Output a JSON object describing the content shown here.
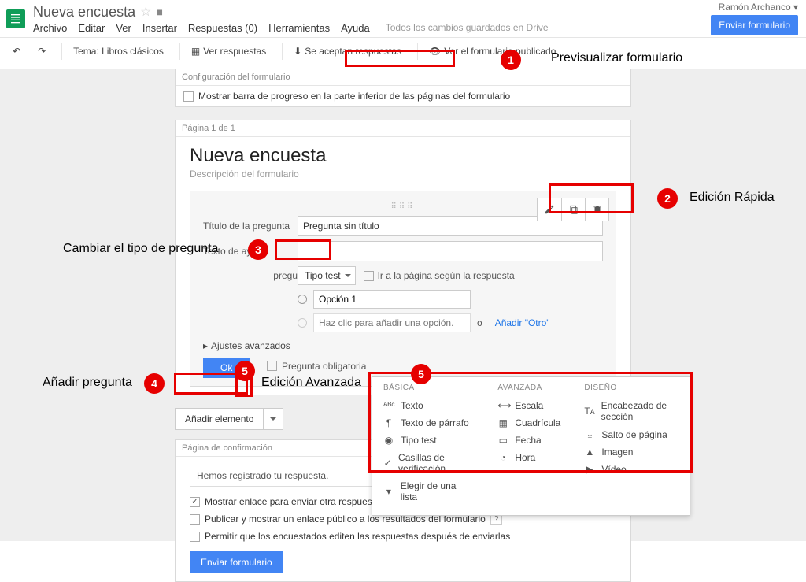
{
  "header": {
    "doc_title": "Nueva encuesta",
    "menus": [
      "Archivo",
      "Editar",
      "Ver",
      "Insertar",
      "Respuestas (0)",
      "Herramientas",
      "Ayuda"
    ],
    "save_status": "Todos los cambios guardados en Drive",
    "user": "Ramón Archanco",
    "send_btn": "Enviar formulario"
  },
  "toolbar": {
    "theme": "Tema: Libros clásicos",
    "view_responses": "Ver respuestas",
    "accepting": "Se aceptan respuestas",
    "view_live": "Ver el formulario publicado"
  },
  "config": {
    "section": "Configuración del formulario",
    "progress_bar": "Mostrar barra de progreso en la parte inferior de las páginas del formulario"
  },
  "form": {
    "page_label": "Página 1 de 1",
    "title": "Nueva encuesta",
    "desc": "Descripción del formulario"
  },
  "question": {
    "title_label": "Título de la pregunta",
    "title_value": "Pregunta sin título",
    "help_label": "Texto de ayuda",
    "type_label": "Tipo de pregunta",
    "type_value": "Tipo test",
    "goto": "Ir a la página según la respuesta",
    "option1": "Opción 1",
    "option_hint": "Haz clic para añadir una opción.",
    "add_other_prefix": "o ",
    "add_other": "Añadir \"Otro\"",
    "advanced": "Ajustes avanzados",
    "ok": "Ok",
    "required": "Pregunta obligatoria"
  },
  "add_element": "Añadir elemento",
  "dropdown": {
    "basic_hdr": "BÁSICA",
    "basic": [
      {
        "icon": "ᴬᴮᶜ",
        "label": "Texto"
      },
      {
        "icon": "¶",
        "label": "Texto de párrafo"
      },
      {
        "icon": "◉",
        "label": "Tipo test"
      },
      {
        "icon": "✓",
        "label": "Casillas de verificación"
      },
      {
        "icon": "▾",
        "label": "Elegir de una lista"
      }
    ],
    "adv_hdr": "AVANZADA",
    "adv": [
      {
        "icon": "⟷",
        "label": "Escala"
      },
      {
        "icon": "▦",
        "label": "Cuadrícula"
      },
      {
        "icon": "▭",
        "label": "Fecha"
      },
      {
        "icon": "◔",
        "label": "Hora"
      }
    ],
    "design_hdr": "DISEÑO",
    "design": [
      {
        "icon": "Tᴀ",
        "label": "Encabezado de sección"
      },
      {
        "icon": "⤓",
        "label": "Salto de página"
      },
      {
        "icon": "▲",
        "label": "Imagen"
      },
      {
        "icon": "▶",
        "label": "Vídeo"
      }
    ]
  },
  "confirm": {
    "section": "Página de confirmación",
    "msg": "Hemos registrado tu respuesta.",
    "rows": [
      {
        "checked": true,
        "label": "Mostrar enlace para enviar otra respuesta"
      },
      {
        "checked": false,
        "label": "Publicar y mostrar un enlace público a los resultados del formulario"
      },
      {
        "checked": false,
        "label": "Permitir que los encuestados editen las respuestas después de enviarlas"
      }
    ],
    "send": "Enviar formulario"
  },
  "annotations": {
    "a1": "Previsualizar formulario",
    "a2": "Edición Rápida",
    "a3": "Cambiar el tipo de pregunta",
    "a4": "Añadir pregunta",
    "a5": "Edición Avanzada"
  }
}
